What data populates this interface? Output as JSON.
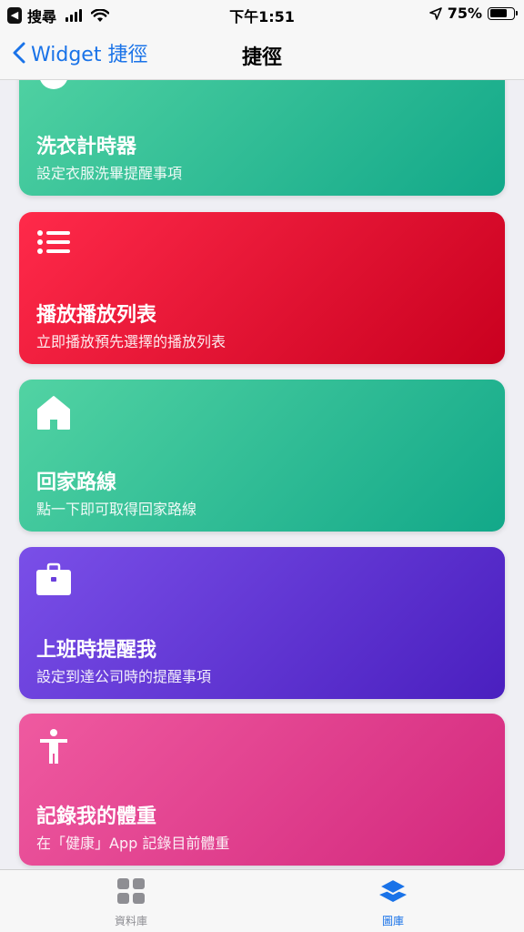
{
  "status_bar": {
    "back_app": "搜尋",
    "time": "下午1:51",
    "battery": "75%",
    "battery_level": 0.75
  },
  "nav": {
    "back_label": "Widget 捷徑",
    "title": "捷徑"
  },
  "cards": [
    {
      "title": "洗衣計時器",
      "subtitle": "設定衣服洗畢提醒事項",
      "icon": "timer-icon",
      "color": "green"
    },
    {
      "title": "播放播放列表",
      "subtitle": "立即播放預先選擇的播放列表",
      "icon": "list-icon",
      "color": "red"
    },
    {
      "title": "回家路線",
      "subtitle": "點一下即可取得回家路線",
      "icon": "house-icon",
      "color": "green"
    },
    {
      "title": "上班時提醒我",
      "subtitle": "設定到達公司時的提醒事項",
      "icon": "briefcase-icon",
      "color": "purple"
    },
    {
      "title": "記錄我的體重",
      "subtitle": "在「健康」App 記錄目前體重",
      "icon": "person-icon",
      "color": "pink"
    }
  ],
  "tabs": [
    {
      "label": "資料庫",
      "icon": "grid-icon",
      "active": false
    },
    {
      "label": "圖庫",
      "icon": "layers-icon",
      "active": true
    }
  ],
  "colors": {
    "accent": "#1a73e8",
    "green": "#12a889",
    "red": "#e0002a",
    "purple": "#5a2fd0",
    "pink": "#e03d8b"
  }
}
